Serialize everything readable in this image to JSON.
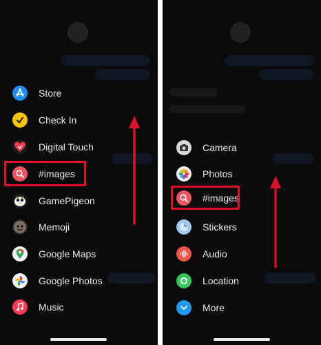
{
  "left_panel": {
    "items": [
      {
        "label": "Store",
        "icon": "app-store-icon",
        "color": "#1e8cf0"
      },
      {
        "label": "Check In",
        "icon": "check-in-icon",
        "color": "#f6c400"
      },
      {
        "label": "Digital Touch",
        "icon": "digital-touch-icon",
        "color": "#e53946"
      },
      {
        "label": "#images",
        "icon": "images-search-icon",
        "color": "#f05463"
      },
      {
        "label": "GamePigeon",
        "icon": "gamepigeon-icon",
        "color": "#f2f2f2"
      },
      {
        "label": "Memoji",
        "icon": "memoji-icon",
        "color": "#7a6f63"
      },
      {
        "label": "Google Maps",
        "icon": "google-maps-icon",
        "color": "#f4f4f4"
      },
      {
        "label": "Google Photos",
        "icon": "google-photos-icon",
        "color": "#f4f4f4"
      },
      {
        "label": "Music",
        "icon": "music-icon",
        "color": "#fa3d57"
      }
    ]
  },
  "right_panel": {
    "items": [
      {
        "label": "Camera",
        "icon": "camera-icon",
        "color": "#d9d9d9"
      },
      {
        "label": "Photos",
        "icon": "photos-icon",
        "color": "#f4f4f4"
      },
      {
        "label": "#images",
        "icon": "images-search-icon",
        "color": "#f05463"
      },
      {
        "label": "Stickers",
        "icon": "stickers-icon",
        "color": "#9fc7f0"
      },
      {
        "label": "Audio",
        "icon": "audio-icon",
        "color": "#f0554a"
      },
      {
        "label": "Location",
        "icon": "location-icon",
        "color": "#34c759"
      },
      {
        "label": "More",
        "icon": "more-chevron-icon",
        "color": "#1e9bf0"
      }
    ]
  },
  "colors": {
    "highlight": "#e0102a",
    "arrow": "#e0102a",
    "background": "#0a0a0a"
  }
}
